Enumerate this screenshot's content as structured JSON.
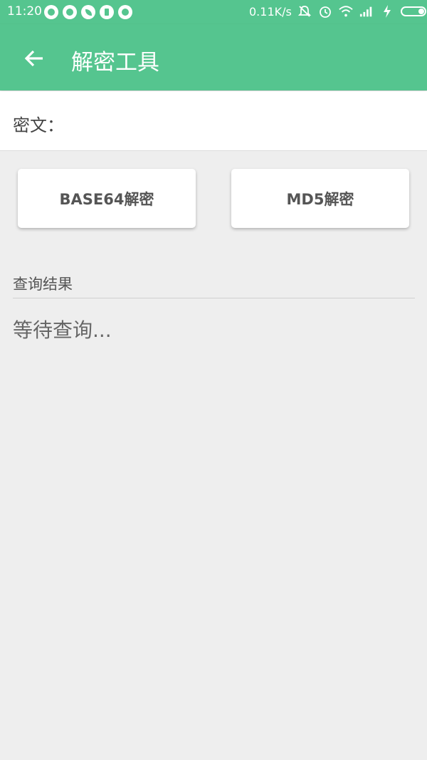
{
  "status_bar": {
    "time": "11:20",
    "net_speed": "0.11K/s",
    "left_icons": [
      "eye-icon",
      "eye-icon",
      "leaf-icon",
      "battery-saver-icon",
      "android-icon"
    ],
    "right_icons": [
      "bell-off-icon",
      "alarm-icon",
      "wifi-icon",
      "signal-icon",
      "charging-icon",
      "battery-icon"
    ]
  },
  "app_bar": {
    "title": "解密工具",
    "back_icon": "arrow-left-icon",
    "color": "#55c58f"
  },
  "cipher": {
    "label": "密文：",
    "value": "",
    "placeholder": ""
  },
  "buttons": {
    "base64": "BASE64解密",
    "md5": "MD5解密"
  },
  "result": {
    "label": "查询结果",
    "text": "等待查询..."
  }
}
